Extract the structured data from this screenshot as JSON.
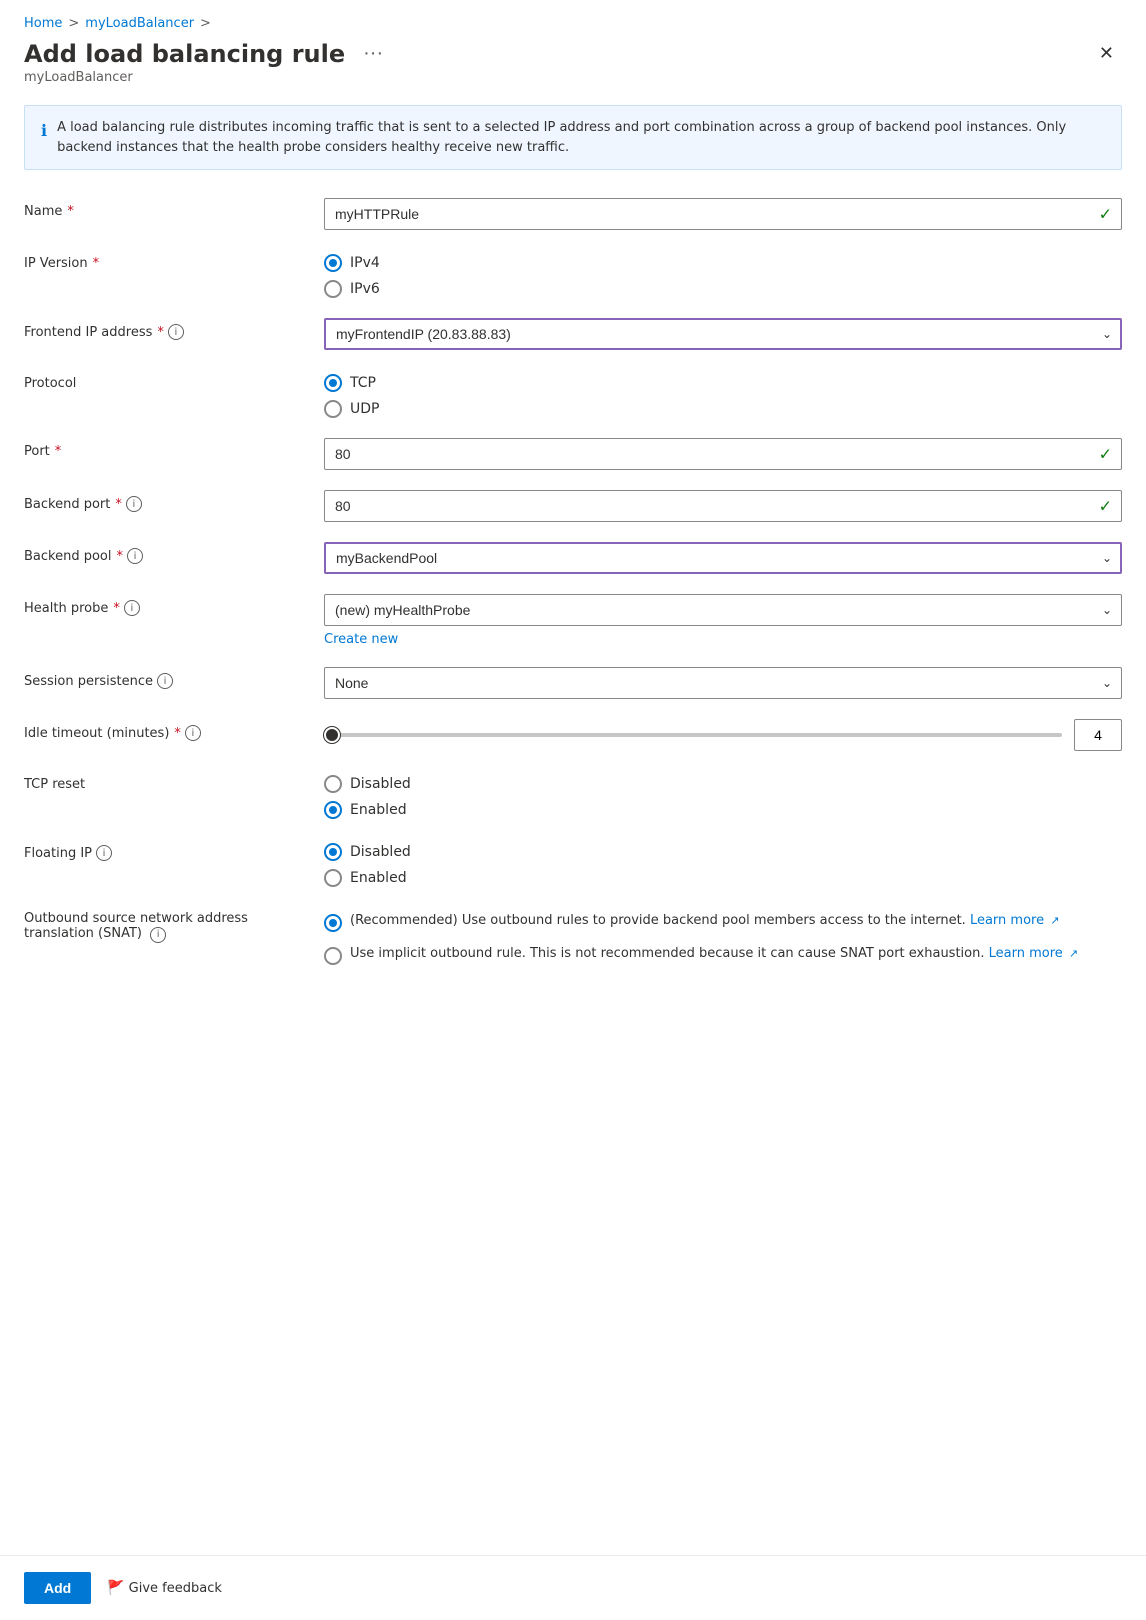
{
  "breadcrumb": {
    "home": "Home",
    "separator1": ">",
    "load_balancer": "myLoadBalancer",
    "separator2": ">"
  },
  "header": {
    "title": "Add load balancing rule",
    "ellipsis": "···",
    "subtitle": "myLoadBalancer"
  },
  "info_box": {
    "text": "A load balancing rule distributes incoming traffic that is sent to a selected IP address and port combination across a group of backend pool instances. Only backend instances that the health probe considers healthy receive new traffic."
  },
  "form": {
    "name": {
      "label": "Name",
      "required": true,
      "value": "myHTTPRule",
      "placeholder": ""
    },
    "ip_version": {
      "label": "IP Version",
      "required": true,
      "options": [
        "IPv4",
        "IPv6"
      ],
      "selected": "IPv4"
    },
    "frontend_ip": {
      "label": "Frontend IP address",
      "required": true,
      "has_info": true,
      "value": "myFrontendIP (20.83.88.83)",
      "active": true
    },
    "protocol": {
      "label": "Protocol",
      "options": [
        "TCP",
        "UDP"
      ],
      "selected": "TCP"
    },
    "port": {
      "label": "Port",
      "required": true,
      "value": "80"
    },
    "backend_port": {
      "label": "Backend port",
      "required": true,
      "has_info": true,
      "value": "80"
    },
    "backend_pool": {
      "label": "Backend pool",
      "required": true,
      "has_info": true,
      "value": "myBackendPool",
      "active": true
    },
    "health_probe": {
      "label": "Health probe",
      "required": true,
      "has_info": true,
      "value": "(new) myHealthProbe",
      "create_new": "Create new"
    },
    "session_persistence": {
      "label": "Session persistence",
      "has_info": true,
      "value": "None"
    },
    "idle_timeout": {
      "label": "Idle timeout (minutes)",
      "required": true,
      "has_info": true,
      "value": 4,
      "min": 4,
      "max": 30
    },
    "tcp_reset": {
      "label": "TCP reset",
      "options": [
        "Disabled",
        "Enabled"
      ],
      "selected": "Enabled"
    },
    "floating_ip": {
      "label": "Floating IP",
      "has_info": true,
      "options": [
        "Disabled",
        "Enabled"
      ],
      "selected": "Disabled"
    },
    "outbound_snat": {
      "label1": "Outbound source network address",
      "label2": "translation (SNAT)",
      "has_info": true,
      "options": [
        {
          "value": "recommended",
          "text": "(Recommended) Use outbound rules to provide backend pool members access to the internet.",
          "learn_more": "Learn more",
          "selected": true
        },
        {
          "value": "implicit",
          "text": "Use implicit outbound rule. This is not recommended because it can cause SNAT port exhaustion.",
          "learn_more": "Learn more",
          "selected": false
        }
      ]
    }
  },
  "footer": {
    "add_label": "Add",
    "feedback_label": "Give feedback"
  }
}
